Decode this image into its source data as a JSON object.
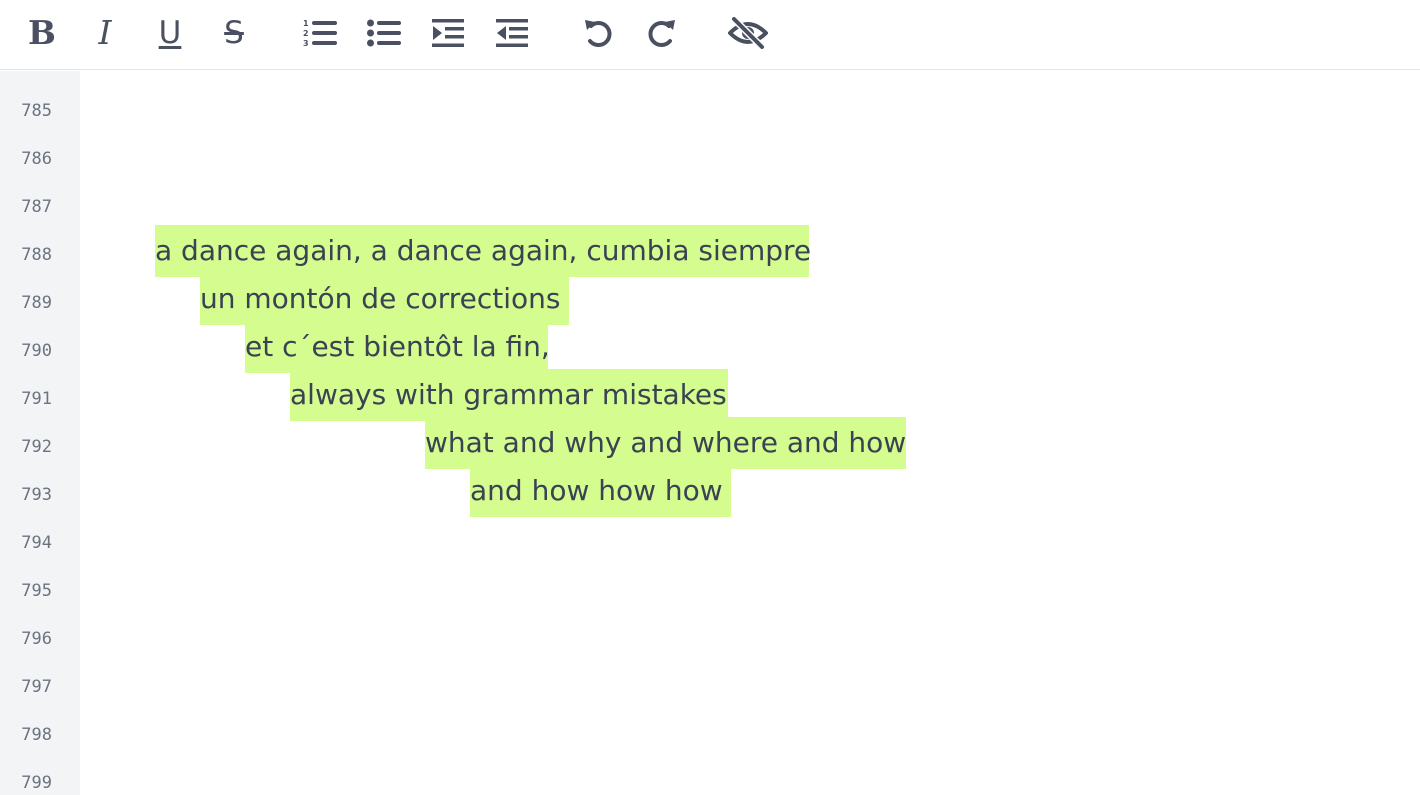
{
  "toolbar": {
    "bold_glyph": "B",
    "italic_glyph": "I",
    "underline_glyph": "U",
    "strike_glyph": "S",
    "icons": [
      "bold-icon",
      "italic-icon",
      "underline-icon",
      "strikethrough-icon",
      "ordered-list-icon",
      "unordered-list-icon",
      "indent-icon",
      "outdent-icon",
      "undo-icon",
      "redo-icon",
      "eye-off-icon"
    ]
  },
  "colors": {
    "highlight": "#d4fc8e",
    "text": "#3a4253",
    "gutter_bg": "#f3f4f6",
    "line_number": "#6b7280",
    "icon": "#4a5060"
  },
  "gutter": {
    "line_numbers": [
      "785",
      "786",
      "787",
      "788",
      "789",
      "790",
      "791",
      "792",
      "793",
      "794",
      "795",
      "796",
      "797",
      "798",
      "799"
    ]
  },
  "editor": {
    "lines": [
      "a dance again, a dance again, cumbia siempre",
      "un montón de corrections",
      "et c´est bientôt la fin,",
      "always with grammar mistakes",
      "what and why and where and how",
      "and how how how"
    ]
  }
}
